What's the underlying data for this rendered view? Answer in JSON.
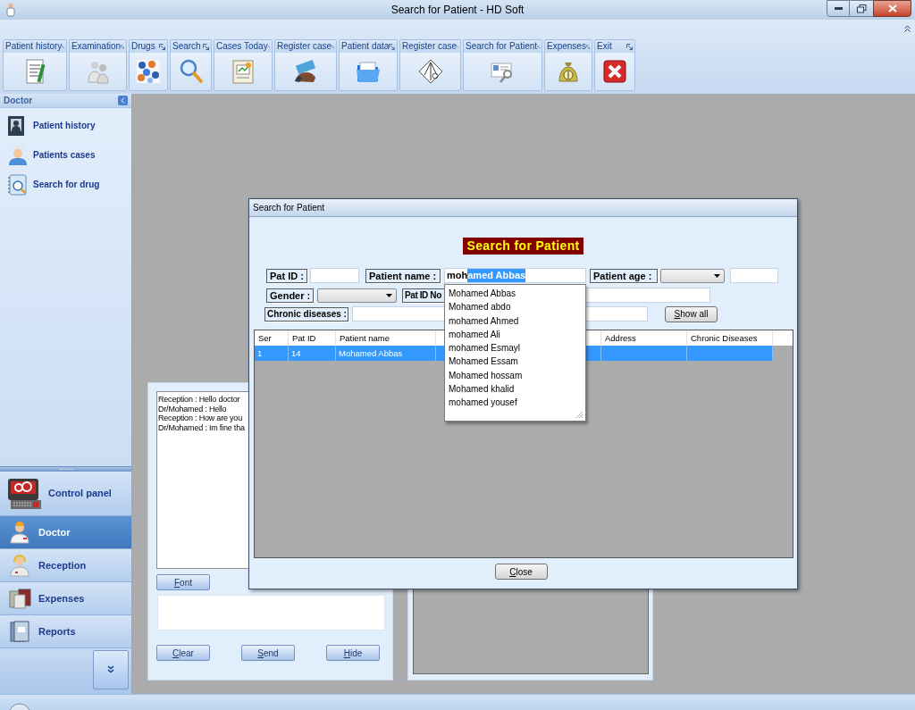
{
  "window": {
    "title": "Search for  Patient - HD Soft"
  },
  "ribbon": {
    "groups": [
      {
        "label": "Patient history"
      },
      {
        "label": "Examination"
      },
      {
        "label": "Drugs"
      },
      {
        "label": "Search"
      },
      {
        "label": "Cases Today"
      },
      {
        "label": "Register case"
      },
      {
        "label": "Patient  data"
      },
      {
        "label": "Register case"
      },
      {
        "label": "Search for  Patient"
      },
      {
        "label": "Expenses"
      },
      {
        "label": "Exit"
      }
    ]
  },
  "navigator": {
    "header": "Doctor",
    "items": [
      {
        "label": "Patient history"
      },
      {
        "label": "Patients cases"
      },
      {
        "label": "Search for drug"
      }
    ],
    "sections": [
      {
        "label": "Control panel",
        "selected": false
      },
      {
        "label": "Doctor",
        "selected": true
      },
      {
        "label": "Reception",
        "selected": false
      },
      {
        "label": "Expenses",
        "selected": false
      },
      {
        "label": "Reports",
        "selected": false
      }
    ]
  },
  "chat": {
    "messages": [
      "Reception : Hello doctor",
      "Dr/Mohamed : Hello",
      "Reception : How are you",
      "Dr/Mohamed : Im fine tha"
    ],
    "font_button": "Font",
    "buttons": [
      "Clear",
      "Send",
      "Hide"
    ]
  },
  "dialog": {
    "title": "Search for  Patient",
    "heading": "Search for  Patient",
    "labels": {
      "pat_id": "Pat ID :",
      "patient_name": "Patient name :",
      "patient_age": "Patient age :",
      "gender": "Gender :",
      "pat_id_no": "Pat ID No",
      "chronic_diseases": "Chronic diseases :"
    },
    "patient_name": {
      "typed": "moh",
      "autocomplete": "amed Abbas"
    },
    "show_all_button": "Show all",
    "suggestions": [
      "Mohamed Abbas",
      "Mohamed abdo",
      "mohamed Ahmed",
      "mohamed Ali",
      "mohamed Esmayl",
      "Mohamed Essam",
      "Mohamed hossam",
      "Mohamed khalid",
      "mohamed yousef"
    ],
    "table": {
      "columns": [
        "Ser",
        "Pat ID",
        "Patient name",
        "Address",
        "Chronic Diseases"
      ],
      "rows": [
        {
          "selected": true,
          "cells": [
            "1",
            "14",
            "Mohamed Abbas"
          ]
        }
      ]
    },
    "close_button": "Close"
  }
}
